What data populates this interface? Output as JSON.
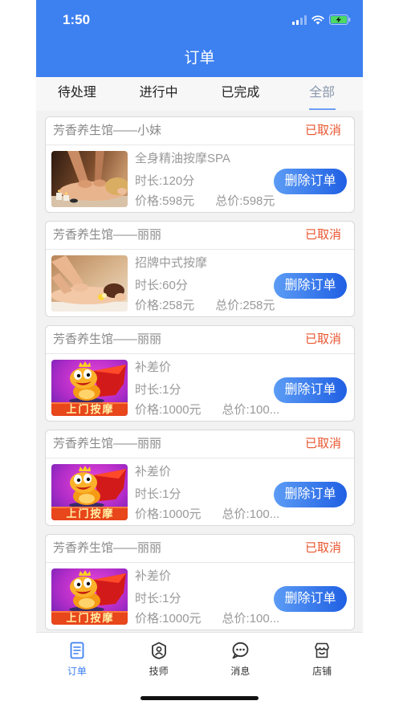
{
  "status_bar": {
    "time": "1:50",
    "icons": [
      "signal-icon",
      "wifi-icon",
      "battery-charging-icon"
    ]
  },
  "nav": {
    "title": "订单"
  },
  "tabs": [
    {
      "label": "待处理",
      "selected": false
    },
    {
      "label": "进行中",
      "selected": false
    },
    {
      "label": "已完成",
      "selected": false
    },
    {
      "label": "全部",
      "selected": true
    }
  ],
  "orders": [
    {
      "shop": "芳香养生馆——小妹",
      "status": "已取消",
      "image": "oil-massage-photo",
      "item": "全身精油按摩SPA",
      "duration": "时长:120分",
      "price": "价格:598元",
      "total": "总价:598元",
      "action": "删除订单"
    },
    {
      "shop": "芳香养生馆——丽丽",
      "status": "已取消",
      "image": "chinese-massage-photo",
      "item": "招牌中式按摩",
      "duration": "时长:60分",
      "price": "价格:258元",
      "total": "总价:258元",
      "action": "删除订单"
    },
    {
      "shop": "芳香养生馆——丽丽",
      "status": "已取消",
      "image": "home-massage-mascot-logo",
      "image_text": "上门按摩",
      "item": "补差价",
      "duration": "时长:1分",
      "price": "价格:1000元",
      "total": "总价:100...",
      "action": "删除订单"
    },
    {
      "shop": "芳香养生馆——丽丽",
      "status": "已取消",
      "image": "home-massage-mascot-logo",
      "image_text": "上门按摩",
      "item": "补差价",
      "duration": "时长:1分",
      "price": "价格:1000元",
      "total": "总价:100...",
      "action": "删除订单"
    },
    {
      "shop": "芳香养生馆——丽丽",
      "status": "已取消",
      "image": "home-massage-mascot-logo",
      "image_text": "上门按摩",
      "item": "补差价",
      "duration": "时长:1分",
      "price": "价格:1000元",
      "total": "总价:100...",
      "action": "删除订单"
    }
  ],
  "bottom_nav": [
    {
      "label": "订单",
      "icon": "order-icon",
      "selected": true
    },
    {
      "label": "技师",
      "icon": "technician-icon",
      "selected": false
    },
    {
      "label": "消息",
      "icon": "message-icon",
      "selected": false
    },
    {
      "label": "店铺",
      "icon": "store-icon",
      "selected": false
    }
  ],
  "colors": {
    "primary": "#3d80f0",
    "status_cancelled": "#e8552f",
    "button_gradient_start": "#5c9cf5",
    "button_gradient_end": "#1f5fe3",
    "battery": "#4cd964",
    "tab_selected_text": "#8b98ad"
  }
}
